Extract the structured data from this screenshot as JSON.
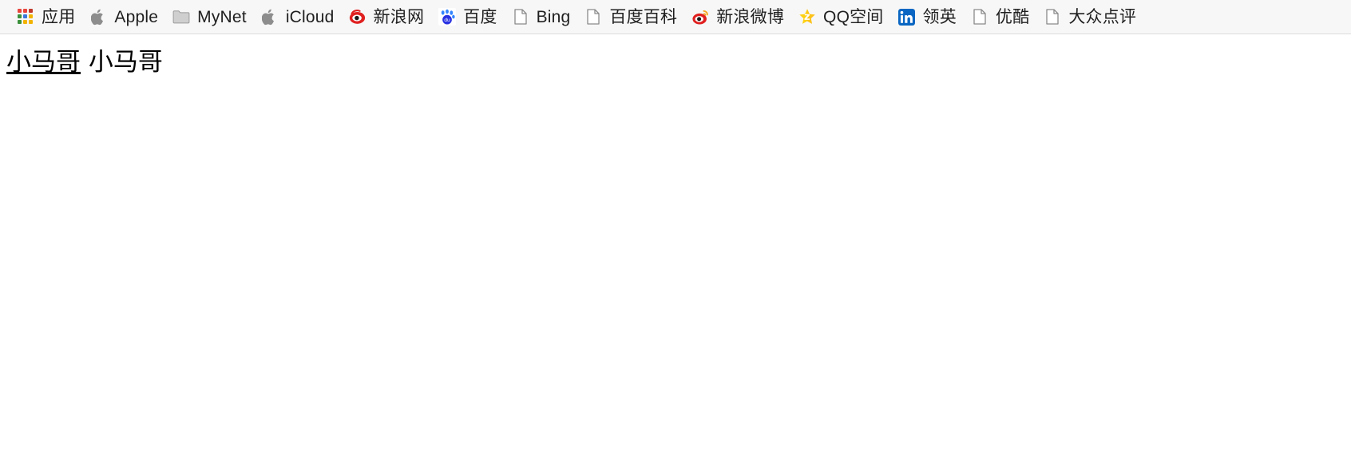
{
  "bookmarks_bar": {
    "background_color": "#f7f7f7",
    "border_color": "#dcdcdc",
    "items": [
      {
        "label": "应用",
        "icon": "apps-grid-icon",
        "icon_colors": [
          "#e8453c",
          "#e8453c",
          "#c0392b",
          "#3a8f3a",
          "#3b77db",
          "#f2b300",
          "#3a8f3a",
          "#f2b300",
          "#f2b300"
        ]
      },
      {
        "label": "Apple",
        "icon": "apple-logo-icon",
        "icon_colors": [
          "#8d8d8d"
        ]
      },
      {
        "label": "MyNet",
        "icon": "folder-icon",
        "icon_colors": [
          "#c9c9c9",
          "#9e9e9e"
        ]
      },
      {
        "label": "iCloud",
        "icon": "apple-logo-icon",
        "icon_colors": [
          "#8d8d8d"
        ]
      },
      {
        "label": "新浪网",
        "icon": "sina-eye-icon",
        "icon_colors": [
          "#e02020",
          "#ffffff",
          "#1a1a1a"
        ]
      },
      {
        "label": "百度",
        "icon": "baidu-paw-icon",
        "icon_colors": [
          "#3385ff",
          "#2932e1",
          "#ffffff"
        ]
      },
      {
        "label": "Bing",
        "icon": "page-document-icon",
        "icon_colors": [
          "#8a8a8a"
        ]
      },
      {
        "label": "百度百科",
        "icon": "page-document-icon",
        "icon_colors": [
          "#8a8a8a"
        ]
      },
      {
        "label": "新浪微博",
        "icon": "weibo-eye-icon",
        "icon_colors": [
          "#e02020",
          "#f5a623",
          "#ffffff"
        ]
      },
      {
        "label": "QQ空间",
        "icon": "qzone-star-icon",
        "icon_colors": [
          "#ffd114",
          "#f5a623",
          "#ffffff"
        ]
      },
      {
        "label": "领英",
        "icon": "linkedin-icon",
        "icon_colors": [
          "#0a66c2",
          "#ffffff"
        ]
      },
      {
        "label": "优酷",
        "icon": "page-document-icon",
        "icon_colors": [
          "#8a8a8a"
        ]
      },
      {
        "label": "大众点评",
        "icon": "page-document-icon",
        "icon_colors": [
          "#8a8a8a"
        ]
      }
    ]
  },
  "main": {
    "line_one": {
      "link_text": "小马哥",
      "separator": " ",
      "plain_text": "小马哥"
    }
  }
}
